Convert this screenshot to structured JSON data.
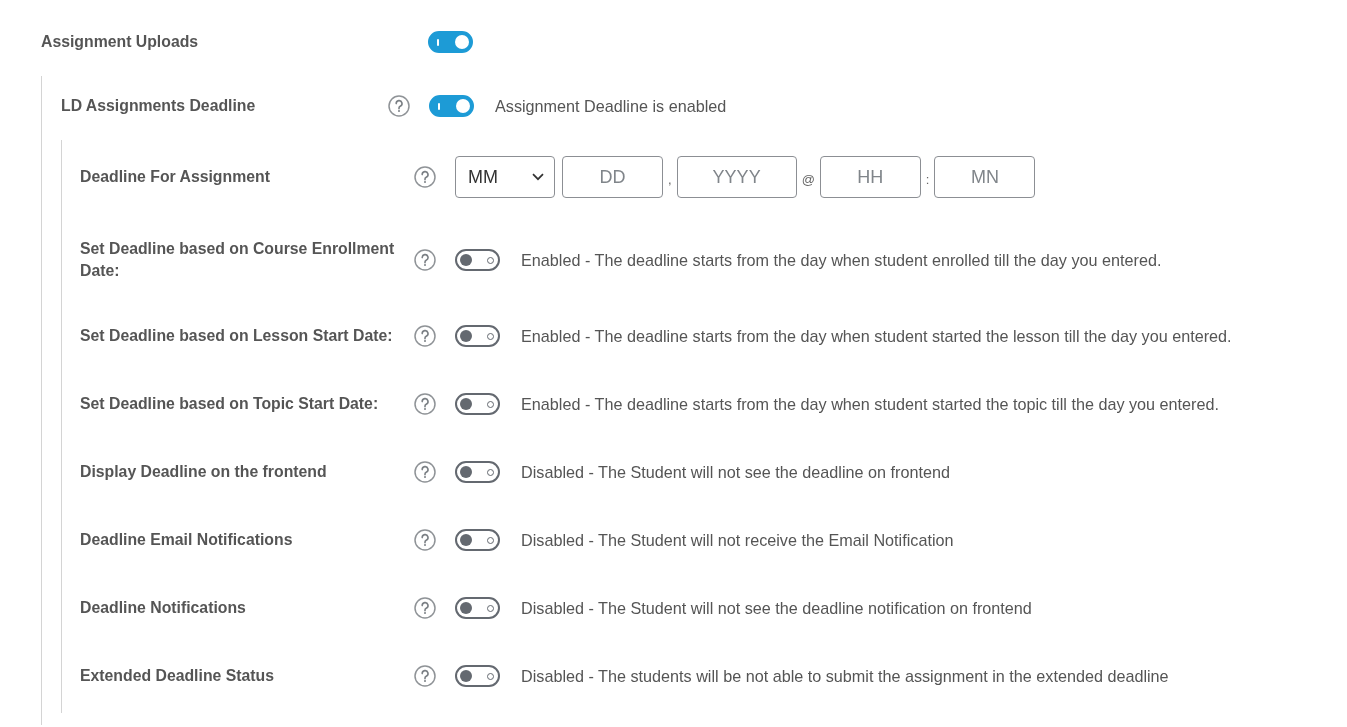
{
  "settings": [
    {
      "kind": "toggle",
      "label": "Assignment Uploads",
      "help": false,
      "on": true,
      "children": [
        {
          "kind": "toggle",
          "label": "LD Assignments Deadline",
          "help": true,
          "on": true,
          "description": "Assignment Deadline is enabled",
          "children": [
            {
              "kind": "date",
              "label": "Deadline For Assignment",
              "help": true,
              "fields": [
                {
                  "kind": "select",
                  "value": "MM"
                },
                {
                  "kind": "input",
                  "placeholder": "DD"
                },
                {
                  "kind": "separator",
                  "text": ","
                },
                {
                  "kind": "input",
                  "placeholder": "YYYY"
                },
                {
                  "kind": "separator",
                  "text": "@"
                },
                {
                  "kind": "input",
                  "placeholder": "HH"
                },
                {
                  "kind": "separator",
                  "text": ":"
                },
                {
                  "kind": "input",
                  "placeholder": "MN"
                }
              ]
            },
            {
              "kind": "toggle",
              "label": "Set Deadline based on Course Enrollment Date:",
              "help": true,
              "on": false,
              "description": "Enabled - The deadline starts from the day when student enrolled till the day you entered."
            },
            {
              "kind": "toggle",
              "label": "Set Deadline based on Lesson Start Date:",
              "help": true,
              "on": false,
              "description": "Enabled - The deadline starts from the day when student started the lesson till the day you entered."
            },
            {
              "kind": "toggle",
              "label": "Set Deadline based on Topic Start Date:",
              "help": true,
              "on": false,
              "description": "Enabled - The deadline starts from the day when student started the topic till the day you entered."
            },
            {
              "kind": "toggle",
              "label": "Display Deadline on the frontend",
              "help": true,
              "on": false,
              "description": "Disabled - The Student will not see the deadline on frontend"
            },
            {
              "kind": "toggle",
              "label": "Deadline Email Notifications",
              "help": true,
              "on": false,
              "description": "Disabled - The Student will not receive the Email Notification"
            },
            {
              "kind": "toggle",
              "label": "Deadline Notifications",
              "help": true,
              "on": false,
              "description": "Disabled - The Student will not see the deadline notification on frontend"
            },
            {
              "kind": "toggle",
              "label": "Extended Deadline Status",
              "help": true,
              "on": false,
              "description": "Disabled - The students will be not able to submit the assignment in the extended deadline"
            }
          ]
        }
      ]
    }
  ]
}
